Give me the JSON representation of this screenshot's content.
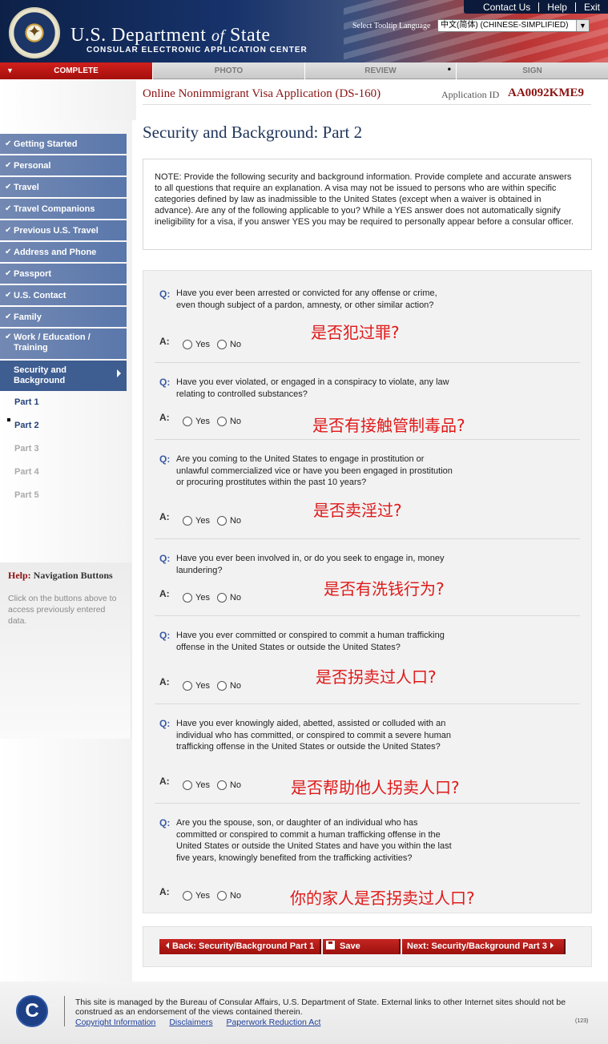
{
  "header": {
    "top_links": [
      "Contact Us",
      "Help",
      "Exit"
    ],
    "dept_title_pre": "U.S. Department",
    "dept_title_of": "of",
    "dept_title_post": "State",
    "subtitle": "CONSULAR ELECTRONIC APPLICATION CENTER",
    "tooltip_label": "Select Tooltip Language",
    "tooltip_language": "中文(简体)  (CHINESE-SIMPLIFIED)"
  },
  "progress_tabs": [
    "COMPLETE",
    "PHOTO",
    "REVIEW",
    "SIGN"
  ],
  "app": {
    "title": "Online Nonimmigrant Visa Application (DS-160)",
    "id_label": "Application ID",
    "id_value": "AA0092KME9"
  },
  "sidebar": {
    "items": [
      "Getting Started",
      "Personal",
      "Travel",
      "Travel Companions",
      "Previous U.S. Travel",
      "Address and Phone",
      "Passport",
      "U.S. Contact",
      "Family",
      "Work / Education / Training",
      "Security and Background"
    ],
    "sub_items": [
      "Part 1",
      "Part 2",
      "Part 3",
      "Part 4",
      "Part 5"
    ],
    "help_title_red": "Help:",
    "help_title_rest": "Navigation Buttons",
    "help_text": "Click on the buttons above to access previously entered data."
  },
  "main": {
    "page_title": "Security and Background: Part 2",
    "note": "NOTE: Provide the following security and background information. Provide complete and accurate answers to all questions that require an explanation. A visa may not be issued to persons who are within specific categories defined by law as inadmissible to the United States (except when a waiver is obtained in advance). Are any of the following applicable to you? While a YES answer does not automatically signify ineligibility for a visa, if you answer YES you may be required to personally appear before a consular officer.",
    "q_label": "Q:",
    "a_label": "A:",
    "yes_label": "Yes",
    "no_label": "No",
    "questions": [
      {
        "text": "Have you ever been arrested or convicted for any offense or crime, even though subject of a pardon, amnesty, or other similar action?",
        "annotation": "是否犯过罪?"
      },
      {
        "text": "Have you ever violated, or engaged in a conspiracy to violate, any law relating to controlled substances?",
        "annotation": "是否有接触管制毒品?"
      },
      {
        "text": "Are you coming to the United States to engage in prostitution or unlawful commercialized vice or have you been engaged in prostitution or procuring prostitutes within the past 10 years?",
        "annotation": "是否卖淫过?"
      },
      {
        "text": "Have you ever been involved in, or do you seek to engage in, money laundering?",
        "annotation": "是否有洗钱行为?"
      },
      {
        "text": "Have you ever committed or conspired to commit a human trafficking offense in the United States or outside the United States?",
        "annotation": "是否拐卖过人口?"
      },
      {
        "text": "Have you ever knowingly aided, abetted, assisted or colluded with an individual who has committed, or conspired to commit a severe human trafficking offense in the United States or outside the United States?",
        "annotation": "是否帮助他人拐卖人口?"
      },
      {
        "text": "Are you the spouse, son, or daughter of an individual who has committed or conspired to commit a human trafficking offense in the United States or outside the United States and have you within the last five years, knowingly benefited from the trafficking activities?",
        "annotation": "你的家人是否拐卖过人口?"
      }
    ]
  },
  "buttons": {
    "back": "Back: Security/Background Part 1",
    "save": "Save",
    "next": "Next: Security/Background Part 3"
  },
  "footer": {
    "text": "This site is managed by the Bureau of Consular Affairs, U.S. Department of State. External links to other Internet sites should not be construed as an endorsement of the views contained therein.",
    "links": [
      "Copyright Information",
      "Disclaimers",
      "Paperwork Reduction Act"
    ],
    "code": "(123)"
  },
  "colors": {
    "nav_blue": "#5a77ab",
    "accent_red": "#8b1212",
    "annotation_red": "#e01919"
  },
  "icons": [
    "check-icon",
    "save-disk-icon",
    "arrow-left-icon",
    "arrow-right-icon",
    "dropdown-arrow-icon",
    "seal-icon",
    "ca-logo-icon"
  ]
}
